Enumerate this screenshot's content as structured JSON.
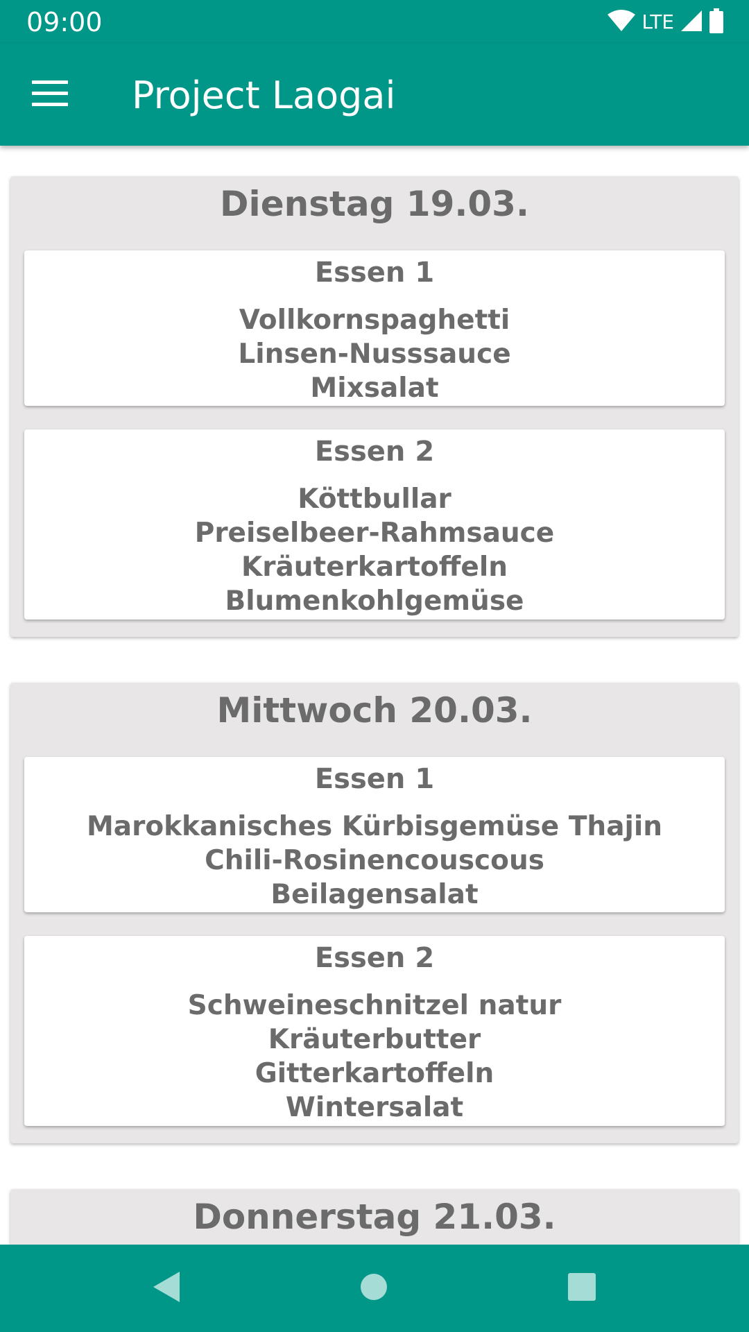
{
  "status_bar": {
    "time": "09:00",
    "network": "LTE",
    "icons": [
      "wifi-icon",
      "signal-icon",
      "battery-icon"
    ]
  },
  "app_bar": {
    "title": "Project Laogai",
    "menu_icon": "menu-icon"
  },
  "days": [
    {
      "title": "Dienstag 19.03.",
      "meals": [
        {
          "title": "Essen 1",
          "items": [
            "Vollkornspaghetti",
            "Linsen-Nusssauce",
            "Mixsalat"
          ]
        },
        {
          "title": "Essen 2",
          "items": [
            "Köttbullar",
            "Preiselbeer-Rahmsauce",
            "Kräuterkartoffeln",
            "Blumenkohlgemüse"
          ]
        }
      ]
    },
    {
      "title": "Mittwoch 20.03.",
      "meals": [
        {
          "title": "Essen 1",
          "items": [
            "Marokkanisches Kürbisgemüse Thajin",
            "Chili-Rosinencouscous",
            "Beilagensalat"
          ]
        },
        {
          "title": "Essen 2",
          "items": [
            "Schweineschnitzel natur",
            "Kräuterbutter",
            "Gitterkartoffeln",
            "Wintersalat"
          ]
        }
      ]
    },
    {
      "title": "Donnerstag 21.03.",
      "meals": []
    }
  ],
  "nav_bar": {
    "icons": [
      "back-icon",
      "home-icon",
      "recents-icon"
    ]
  },
  "colors": {
    "primary": "#009688",
    "card_background": "#e8e6e7",
    "text": "#6b6b6b"
  }
}
